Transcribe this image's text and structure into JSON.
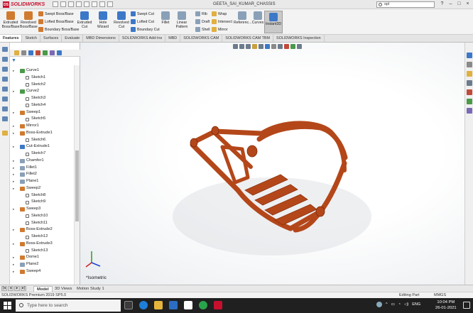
{
  "titlebar": {
    "brand": "SOLIDWORKS",
    "document_title": "GEETA_SAI_KUMAR_CHASSIS",
    "search_value": "spl",
    "window_controls": [
      "?",
      "–",
      "□",
      "×"
    ]
  },
  "ribbon": {
    "extruded_boss": "Extruded Boss/Base",
    "revolved_boss": "Revolved Boss/Base",
    "swept_boss": "Swept Boss/Base",
    "lofted_boss": "Lofted Boss/Base",
    "boundary_boss": "Boundary Boss/Base",
    "extruded_cut": "Extruded Cut",
    "hole_wizard": "Hole Wizard",
    "revolved_cut": "Revolved Cut",
    "swept_cut": "Swept Cut",
    "lofted_cut": "Lofted Cut",
    "boundary_cut": "Boundary Cut",
    "fillet": "Fillet",
    "linear_pattern": "Linear Pattern",
    "rib": "Rib",
    "draft": "Draft",
    "shell": "Shell",
    "wrap": "Wrap",
    "intersect": "Intersect",
    "mirror": "Mirror",
    "reference": "Referenc...",
    "curves": "Curves",
    "instant3d": "Instant3D"
  },
  "command_tabs": [
    "Features",
    "Sketch",
    "Surfaces",
    "Evaluate",
    "MBD Dimensions",
    "SOLIDWORKS Add-Ins",
    "MBD",
    "SOLIDWORKS CAM",
    "SOLIDWORKS CAM TBM",
    "SOLIDWORKS Inspection"
  ],
  "feature_tree": [
    {
      "label": "Curve1",
      "level": "top",
      "icon": "curve-icon"
    },
    {
      "label": "Sketch1",
      "level": "child",
      "icon": "sketch-icon"
    },
    {
      "label": "Sketch2",
      "level": "child",
      "icon": "sketch-icon"
    },
    {
      "label": "Curve2",
      "level": "top",
      "icon": "curve-icon"
    },
    {
      "label": "Sketch3",
      "level": "child",
      "icon": "sketch-icon"
    },
    {
      "label": "Sketch4",
      "level": "child",
      "icon": "sketch-icon"
    },
    {
      "label": "Sweep1",
      "level": "top",
      "icon": "sweep-icon"
    },
    {
      "label": "Sketch5",
      "level": "child",
      "icon": "sketch-icon"
    },
    {
      "label": "Mirror1",
      "level": "top",
      "icon": "mirror-icon"
    },
    {
      "label": "Boss-Extrude1",
      "level": "top",
      "icon": "extrude-icon"
    },
    {
      "label": "Sketch6",
      "level": "child",
      "icon": "sketch-icon"
    },
    {
      "label": "Cut-Extrude1",
      "level": "top",
      "icon": "cut-icon"
    },
    {
      "label": "Sketch7",
      "level": "child",
      "icon": "sketch-icon"
    },
    {
      "label": "Chamfer1",
      "level": "top",
      "icon": "chamfer-icon"
    },
    {
      "label": "Fillet1",
      "level": "top",
      "icon": "fillet-icon"
    },
    {
      "label": "Fillet2",
      "level": "top",
      "icon": "fillet-icon"
    },
    {
      "label": "Plane1",
      "level": "top",
      "icon": "plane-icon"
    },
    {
      "label": "Sweep2",
      "level": "top",
      "icon": "sweep-icon"
    },
    {
      "label": "Sketch8",
      "level": "child",
      "icon": "sketch-icon"
    },
    {
      "label": "Sketch9",
      "level": "child",
      "icon": "sketch-icon"
    },
    {
      "label": "Sweep3",
      "level": "top",
      "icon": "sweep-icon"
    },
    {
      "label": "Sketch10",
      "level": "child",
      "icon": "sketch-icon"
    },
    {
      "label": "Sketch11",
      "level": "child",
      "icon": "sketch-icon"
    },
    {
      "label": "Boss-Extrude2",
      "level": "top",
      "icon": "extrude-icon"
    },
    {
      "label": "Sketch12",
      "level": "child",
      "icon": "sketch-icon"
    },
    {
      "label": "Boss-Extrude3",
      "level": "top",
      "icon": "extrude-icon"
    },
    {
      "label": "Sketch13",
      "level": "child",
      "icon": "sketch-icon"
    },
    {
      "label": "Dome1",
      "level": "top",
      "icon": "dome-icon"
    },
    {
      "label": "Plane2",
      "level": "top",
      "icon": "plane-icon"
    },
    {
      "label": "Sweep4",
      "level": "top",
      "icon": "sweep-icon"
    }
  ],
  "viewport": {
    "view_label": "*Isometric",
    "model_color": "#b4471a"
  },
  "bottom_tabs": [
    "Model",
    "3D Views",
    "Motion Study 1"
  ],
  "statusbar": {
    "product": "SOLIDWORKS Premium 2019 SP5.0",
    "mode": "Editing Part",
    "units": "MMGS"
  },
  "taskbar": {
    "search_placeholder": "Type here to search",
    "language": "ENG",
    "time": "10:04 PM",
    "date": "26-01-2021"
  }
}
